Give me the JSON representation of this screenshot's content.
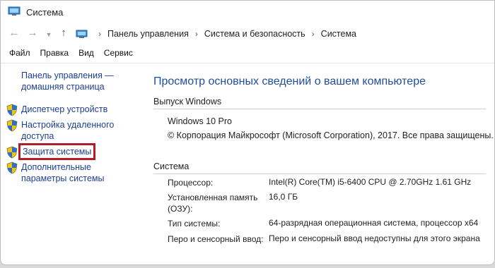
{
  "window": {
    "title": "Система"
  },
  "address": {
    "crumbs": [
      "Панель управления",
      "Система и безопасность",
      "Система"
    ]
  },
  "menu": [
    "Файл",
    "Правка",
    "Вид",
    "Сервис"
  ],
  "sidebar": {
    "home": "Панель управления — домашняя страница",
    "links": [
      "Диспетчер устройств",
      "Настройка удаленного доступа",
      "Защита системы",
      "Дополнительные параметры системы"
    ]
  },
  "main": {
    "heading": "Просмотр основных сведений о вашем компьютере",
    "edition": {
      "title": "Выпуск Windows",
      "name": "Windows 10 Pro",
      "copyright": "© Корпорация Майкрософт (Microsoft Corporation), 2017. Все права защищены."
    },
    "system": {
      "title": "Система",
      "rows": [
        {
          "label": "Процессор:",
          "value": "Intel(R) Core(TM) i5-6400 CPU @ 2.70GHz   1.61 GHz"
        },
        {
          "label": "Установленная память (ОЗУ):",
          "value": "16,0 ГБ"
        },
        {
          "label": "Тип системы:",
          "value": "64-разрядная операционная система, процессор x64"
        },
        {
          "label": "Перо и сенсорный ввод:",
          "value": "Перо и сенсорный ввод недоступны для этого экрана"
        }
      ]
    }
  },
  "colors": {
    "link": "#1c3f95",
    "heading": "#1f4e9e",
    "highlight": "#b31d27"
  }
}
